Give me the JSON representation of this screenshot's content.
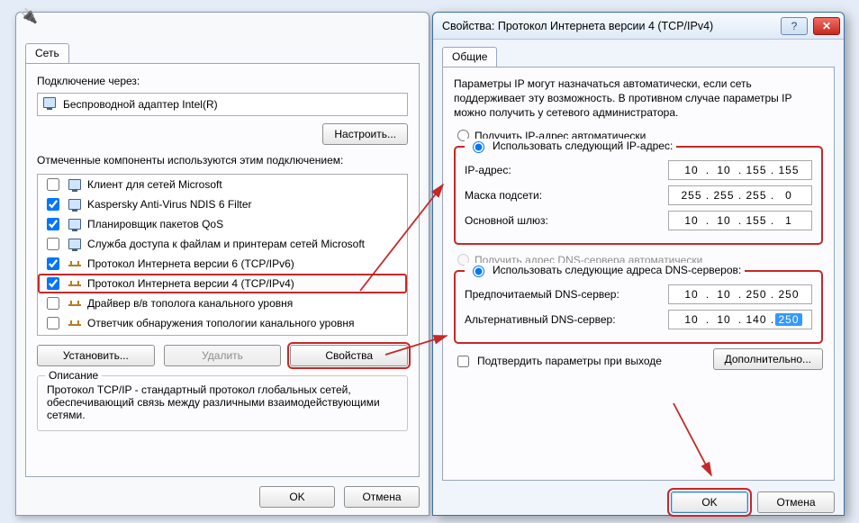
{
  "left": {
    "tab_label": "Сеть",
    "connect_via_label": "Подключение через:",
    "adapter": "Беспроводной адаптер Intel(R)",
    "configure_btn": "Настроить...",
    "components_label": "Отмеченные компоненты используются этим подключением:",
    "components": [
      {
        "checked": false,
        "icon": "client",
        "label": "Клиент для сетей Microsoft"
      },
      {
        "checked": true,
        "icon": "client",
        "label": "Kaspersky Anti-Virus NDIS 6 Filter"
      },
      {
        "checked": true,
        "icon": "client",
        "label": "Планировщик пакетов QoS"
      },
      {
        "checked": false,
        "icon": "service",
        "label": "Служба доступа к файлам и принтерам сетей Microsoft"
      },
      {
        "checked": true,
        "icon": "protocol",
        "label": "Протокол Интернета версии 6 (TCP/IPv6)"
      },
      {
        "checked": true,
        "icon": "protocol",
        "label": "Протокол Интернета версии 4 (TCP/IPv4)",
        "highlight": true
      },
      {
        "checked": false,
        "icon": "protocol",
        "label": "Драйвер в/в тополога канального уровня"
      },
      {
        "checked": false,
        "icon": "protocol",
        "label": "Ответчик обнаружения топологии канального уровня"
      }
    ],
    "install_btn": "Установить...",
    "remove_btn": "Удалить",
    "props_btn": "Свойства",
    "desc_legend": "Описание",
    "desc_text": "Протокол TCP/IP - стандартный протокол глобальных сетей, обеспечивающий связь между различными взаимодействующими сетями.",
    "ok_btn": "OK",
    "cancel_btn": "Отмена"
  },
  "right": {
    "title": "Свойства: Протокол Интернета версии 4 (TCP/IPv4)",
    "tab_label": "Общие",
    "intro": "Параметры IP могут назначаться автоматически, если сеть поддерживает эту возможность. В противном случае параметры IP можно получить у сетевого администратора.",
    "ip_auto_label": "Получить IP-адрес автоматически",
    "ip_manual_label": "Использовать следующий IP-адрес:",
    "ip_addr_label": "IP-адрес:",
    "ip_addr": [
      "10",
      "10",
      "155",
      "155"
    ],
    "mask_label": "Маска подсети:",
    "mask": [
      "255",
      "255",
      "255",
      "0"
    ],
    "gateway_label": "Основной шлюз:",
    "gateway": [
      "10",
      "10",
      "155",
      "1"
    ],
    "dns_auto_label": "Получить адрес DNS-сервера автоматически",
    "dns_manual_label": "Использовать следующие адреса DNS-серверов:",
    "dns_pref_label": "Предпочитаемый DNS-сервер:",
    "dns_pref": [
      "10",
      "10",
      "250",
      "250"
    ],
    "dns_alt_label": "Альтернативный DNS-сервер:",
    "dns_alt": [
      "10",
      "10",
      "140",
      "250"
    ],
    "confirm_label": "Подтвердить параметры при выходе",
    "advanced_btn": "Дополнительно...",
    "ok_btn": "OK",
    "cancel_btn": "Отмена",
    "help_glyph": "?",
    "close_glyph": "✕"
  }
}
